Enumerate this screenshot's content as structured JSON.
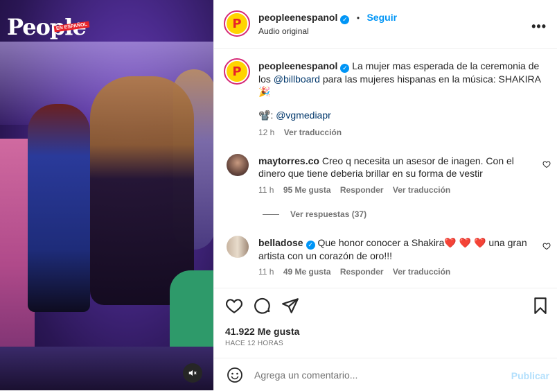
{
  "video": {
    "logo_text": "People",
    "logo_tag": "EN ESPAÑOL",
    "mute_icon": "speaker-muted-icon"
  },
  "header": {
    "username": "peopleenespanol",
    "separator": "•",
    "follow_label": "Seguir",
    "subtitle": "Audio original",
    "avatar_letter": "P"
  },
  "caption": {
    "username": "peopleenespanol",
    "text_part1": "La mujer mas esperada de la ceremonia de los ",
    "mention": "@billboard",
    "text_part2": " para las mujeres hispanas en la música: SHAKIRA ",
    "emoji": "🎉",
    "credit_emoji": "📽️",
    "credit_sep": ": ",
    "credit_mention": "@vgmediapr",
    "time": "12 h",
    "translate_label": "Ver traducción"
  },
  "comments": [
    {
      "username": "maytorres.co",
      "text": "Creo q necesita un asesor de inagen. Con el dinero que tiene deberia brillar en su forma de vestir",
      "time": "11 h",
      "likes": "95 Me gusta",
      "reply_label": "Responder",
      "translate_label": "Ver traducción",
      "replies_label": "Ver respuestas (37)"
    },
    {
      "username": "belladose",
      "text_part1": "Que honor conocer a Shakira",
      "hearts": "❤️ ❤️ ❤️",
      "text_part2": " una gran artista con un corazón de oro!!!",
      "time": "11 h",
      "likes": "49 Me gusta",
      "reply_label": "Responder",
      "translate_label": "Ver traducción"
    }
  ],
  "footer": {
    "likes": "41.922 Me gusta",
    "timestamp": "HACE 12 HORAS",
    "comment_placeholder": "Agrega un comentario...",
    "post_label": "Publicar"
  },
  "colors": {
    "accent": "#0095f6",
    "text": "#262626",
    "muted": "#737373",
    "post_disabled": "#b2dffc"
  }
}
